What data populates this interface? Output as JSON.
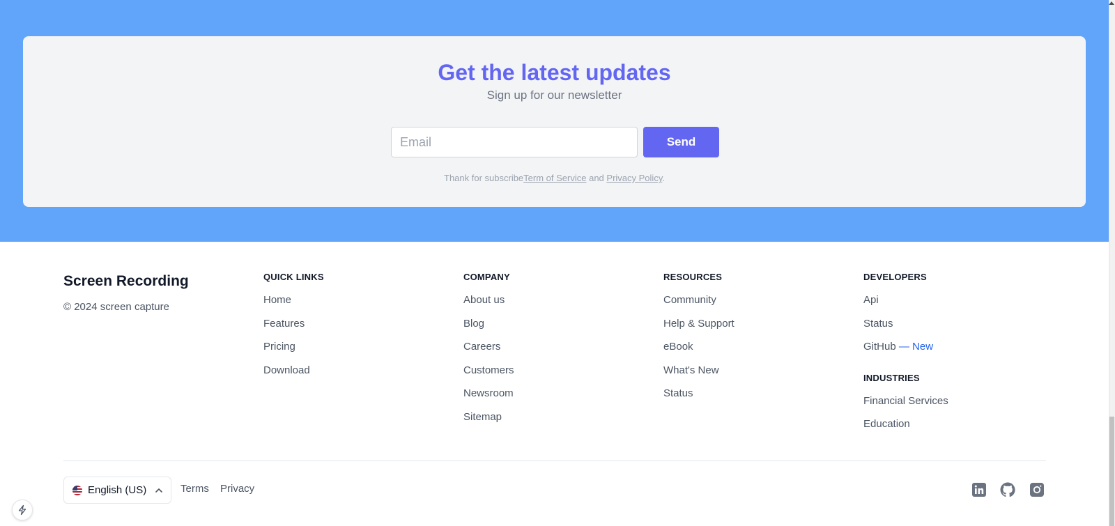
{
  "newsletter": {
    "title": "Get the latest updates",
    "subtitle": "Sign up for our newsletter",
    "email_placeholder": "Email",
    "send_label": "Send",
    "legal_prefix": "Thank for subscribe",
    "terms_link": "Term of Service",
    "legal_and": " and ",
    "privacy_link": "Privacy Policy",
    "legal_suffix": ".",
    "band_color": "#60a5fa",
    "accent_color": "#6366f1"
  },
  "footer": {
    "brand": "Screen Recording",
    "copyright": "© 2024 screen capture",
    "columns": [
      {
        "heading": "QUICK LINKS",
        "links": [
          "Home",
          "Features",
          "Pricing",
          "Download"
        ]
      },
      {
        "heading": "COMPANY",
        "links": [
          "About us",
          "Blog",
          "Careers",
          "Customers",
          "Newsroom",
          "Sitemap"
        ]
      },
      {
        "heading": "RESOURCES",
        "links": [
          "Community",
          "Help & Support",
          "eBook",
          "What's New",
          "Status"
        ]
      },
      {
        "heading": "DEVELOPERS",
        "links": [
          "Api",
          "Status",
          "GitHub"
        ],
        "github_badge": "— New",
        "heading_2": "INDUSTRIES",
        "links_2": [
          "Financial Services",
          "Education"
        ]
      }
    ],
    "language": "English (US)",
    "bottom_links": [
      "Terms",
      "Privacy"
    ],
    "social_icons": [
      "linkedin-icon",
      "github-icon",
      "instagram-icon"
    ]
  }
}
